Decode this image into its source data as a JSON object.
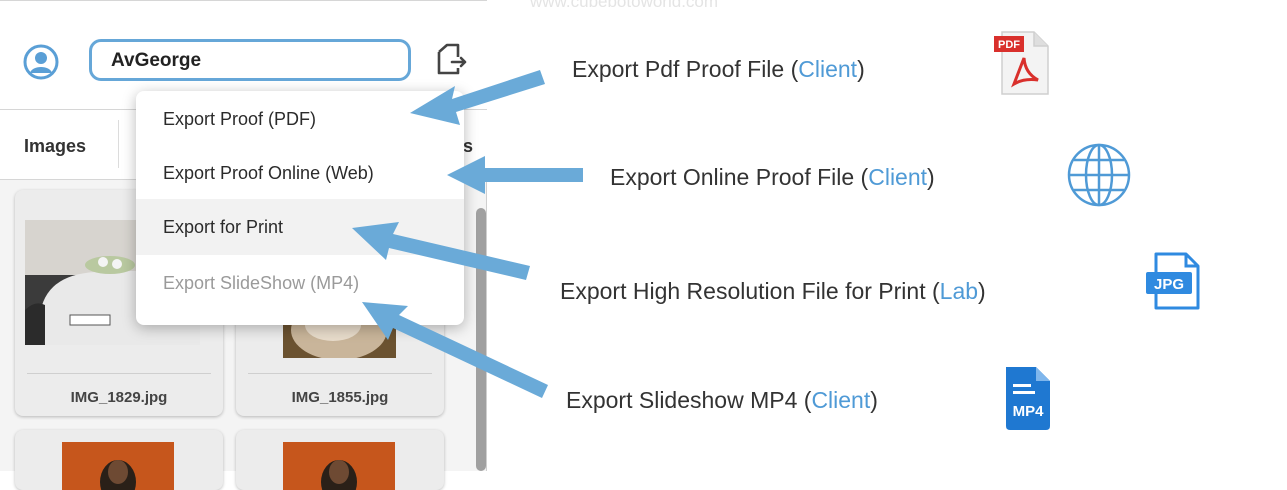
{
  "watermark": "www.cubebotoworld.com",
  "user": {
    "name": "AvGeorge"
  },
  "tabs": {
    "images": "Images",
    "cut_label": "s"
  },
  "thumbnails": [
    {
      "caption": "IMG_1829.jpg"
    },
    {
      "caption": "IMG_1855.jpg"
    }
  ],
  "menu": {
    "items": [
      {
        "label": "Export Proof (PDF)",
        "state": "normal"
      },
      {
        "label": "Export Proof Online (Web)",
        "state": "normal"
      },
      {
        "label": "Export for Print",
        "state": "highlighted"
      },
      {
        "label": "Export SlideShow (MP4)",
        "state": "disabled"
      }
    ]
  },
  "annotations": [
    {
      "text": "Export Pdf Proof File (",
      "highlight": "Client",
      "suffix": ")",
      "icon": "pdf-file-icon"
    },
    {
      "text": "Export Online Proof File (",
      "highlight": "Client",
      "suffix": ")",
      "icon": "globe-icon"
    },
    {
      "text": "Export High Resolution File for Print (",
      "highlight": "Lab",
      "suffix": ")",
      "icon": "jpg-file-icon"
    },
    {
      "text": "Export Slideshow MP4 (",
      "highlight": "Client",
      "suffix": ")",
      "icon": "mp4-file-icon"
    }
  ],
  "icon_labels": {
    "pdf": "PDF",
    "jpg": "JPG",
    "mp4": "MP4"
  },
  "colors": {
    "accent": "#4f9ad6",
    "arrow": "#6aaad8",
    "field_border": "#66a7d8",
    "pdf_red": "#d9302c",
    "mp4_blue": "#1f78d1"
  }
}
